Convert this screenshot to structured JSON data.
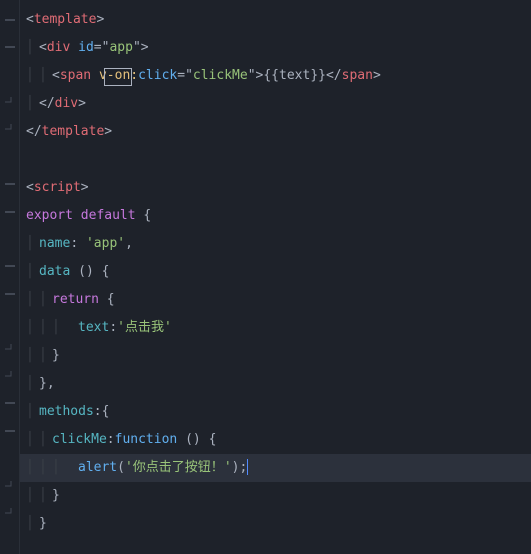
{
  "gutter_icons": [
    "minus",
    "minus",
    "",
    "",
    "minus",
    "",
    "minus",
    "",
    "",
    "minus",
    "minus",
    "",
    "",
    "minus",
    "minus",
    "",
    "",
    "minus",
    "",
    "",
    "minus",
    "",
    "minus",
    "minus",
    "",
    "",
    "minus",
    "",
    "minus",
    ""
  ],
  "code": {
    "l1": {
      "oAngle": "<",
      "tag": "template",
      "cAngle": ">"
    },
    "l2": {
      "indent": "  ",
      "oAngle": "<",
      "tag": "div",
      "sp": " ",
      "attr": "id",
      "eq": "=",
      "q": "\"",
      "val": "app",
      "cAngle": ">"
    },
    "l3": {
      "indent": "    ",
      "oAngle": "<",
      "tag": "span",
      "sp": " ",
      "dir": "v-on:",
      "evt": "click",
      "eq": "=",
      "q": "\"",
      "val": "clickMe",
      "cAngle": ">",
      "mustache": "{{text}}",
      "oClose": "</",
      "cAngle2": ">"
    },
    "l4": {
      "indent": "  ",
      "oClose": "</",
      "tag": "div",
      "cAngle": ">"
    },
    "l5": {
      "oClose": "</",
      "tag": "template",
      "cAngle": ">"
    },
    "l6": {
      "blank": ""
    },
    "l7": {
      "oAngle": "<",
      "tag": "script",
      "cAngle": ">"
    },
    "l8": {
      "kw1": "export",
      "sp": " ",
      "kw2": "default",
      "sp2": " ",
      "brace": "{"
    },
    "l9": {
      "indent": "  ",
      "key": "name",
      "colon": ":",
      "sp": " ",
      "q": "'",
      "val": "app",
      "comma": ","
    },
    "l10": {
      "indent": "  ",
      "key": "data",
      "sp": " ",
      "paren": "()",
      "sp2": " ",
      "brace": "{"
    },
    "l11": {
      "indent": "    ",
      "kw": "return",
      "sp": " ",
      "brace": "{"
    },
    "l12": {
      "indent": "        ",
      "key": "text",
      "colon": ":",
      "q": "'",
      "val": "点击我"
    },
    "l13": {
      "indent": "    ",
      "brace": "}"
    },
    "l14": {
      "indent": "  ",
      "brace": "}",
      "comma": ","
    },
    "l15": {
      "indent": "  ",
      "key": "methods",
      "colon": ":",
      "brace": "{"
    },
    "l16": {
      "indent": "    ",
      "key": "clickMe",
      "colon": ":",
      "fn": "function",
      "sp": " ",
      "paren": "()",
      "sp2": " ",
      "brace": "{"
    },
    "l17": {
      "indent": "        ",
      "fn": "alert",
      "open": "(",
      "q": "'",
      "val": "你点击了按钮！",
      "close": ")",
      "semi": ";"
    },
    "l18": {
      "indent": "    ",
      "brace": "}"
    },
    "l19": {
      "indent": "  ",
      "brace": "}"
    }
  }
}
